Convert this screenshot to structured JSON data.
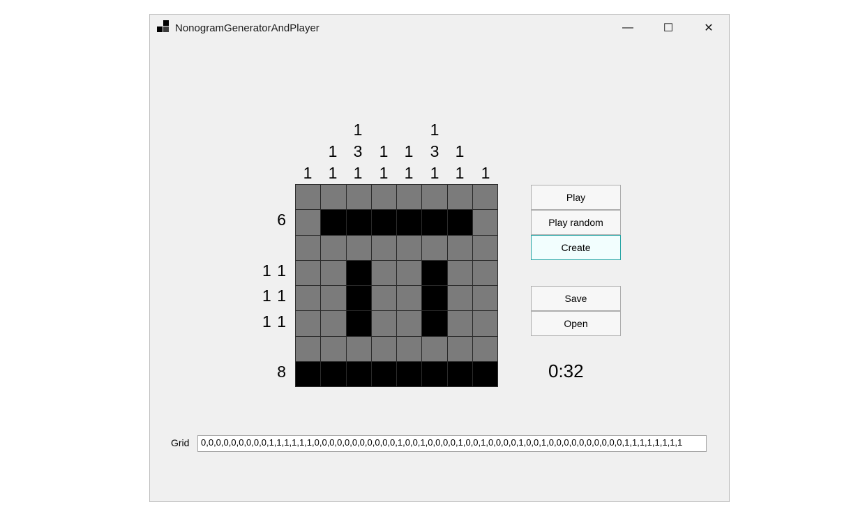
{
  "window": {
    "title": "NonogramGeneratorAndPlayer"
  },
  "titlebar_buttons": {
    "minimize": "—",
    "maximize": "☐",
    "close": "✕"
  },
  "column_clues": [
    [
      "1"
    ],
    [
      "1",
      "1"
    ],
    [
      "1",
      "3",
      "1"
    ],
    [
      "1",
      "1"
    ],
    [
      "1",
      "1"
    ],
    [
      "1",
      "3",
      "1"
    ],
    [
      "1",
      "1"
    ],
    [
      "1"
    ]
  ],
  "row_clues": [
    "",
    "6",
    "",
    "1 1",
    "1 1",
    "1 1",
    "",
    "8"
  ],
  "grid": {
    "cells": [
      [
        0,
        0,
        0,
        0,
        0,
        0,
        0,
        0
      ],
      [
        0,
        1,
        1,
        1,
        1,
        1,
        1,
        0
      ],
      [
        0,
        0,
        0,
        0,
        0,
        0,
        0,
        0
      ],
      [
        0,
        0,
        1,
        0,
        0,
        1,
        0,
        0
      ],
      [
        0,
        0,
        1,
        0,
        0,
        1,
        0,
        0
      ],
      [
        0,
        0,
        1,
        0,
        0,
        1,
        0,
        0
      ],
      [
        0,
        0,
        0,
        0,
        0,
        0,
        0,
        0
      ],
      [
        1,
        1,
        1,
        1,
        1,
        1,
        1,
        1
      ]
    ]
  },
  "buttons": {
    "play": "Play",
    "play_random": "Play random",
    "create": "Create",
    "save": "Save",
    "open": "Open"
  },
  "timer": "0:32",
  "grid_field": {
    "label": "Grid",
    "value": "0,0,0,0,0,0,0,0,0,1,1,1,1,1,1,0,0,0,0,0,0,0,0,0,0,0,1,0,0,1,0,0,0,0,1,0,0,1,0,0,0,0,1,0,0,1,0,0,0,0,0,0,0,0,0,0,1,1,1,1,1,1,1,1"
  }
}
